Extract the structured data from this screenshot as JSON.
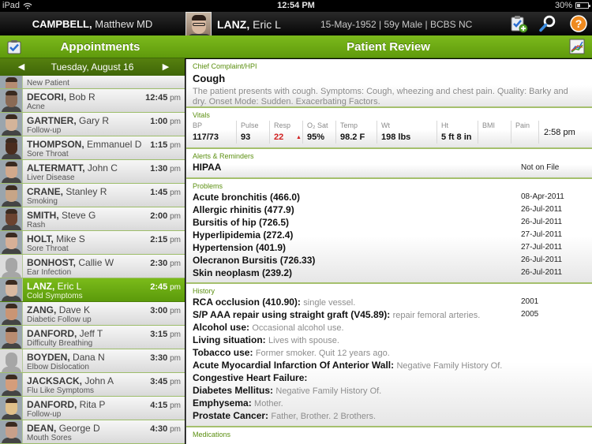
{
  "status_bar": {
    "device": "iPad",
    "time": "12:54 PM",
    "battery": "30%"
  },
  "header": {
    "doctor_last": "CAMPBELL,",
    "doctor_first": "Matthew MD",
    "patient_last": "LANZ,",
    "patient_first": "Eric L",
    "patient_meta": "15-May-1952 | 59y Male | BCBS NC",
    "icons": [
      "add-appointment-icon",
      "search-icon",
      "help-icon"
    ]
  },
  "appointments": {
    "title": "Appointments",
    "date": "Tuesday, August 16",
    "prev_label": "◀",
    "next_label": "▶",
    "items": [
      {
        "last": "",
        "first": "",
        "reason": "New Patient",
        "time": "",
        "ampm": "",
        "photo": "#b58c72",
        "partial": true
      },
      {
        "last": "DECORI,",
        "first": "Bob R",
        "reason": "Acne",
        "time": "12:45",
        "ampm": "pm",
        "photo": "#8a6a55"
      },
      {
        "last": "GARTNER,",
        "first": "Gary R",
        "reason": "Follow-up",
        "time": "1:00",
        "ampm": "pm",
        "photo": "#d4b49a"
      },
      {
        "last": "THOMPSON,",
        "first": "Emmanuel D",
        "reason": "Sore Throat",
        "time": "1:15",
        "ampm": "pm",
        "photo": "#4a2d1e"
      },
      {
        "last": "ALTERMATT,",
        "first": "John C",
        "reason": "Liver Disease",
        "time": "1:30",
        "ampm": "pm",
        "photo": "#d2a98c"
      },
      {
        "last": "CRANE,",
        "first": "Stanley R",
        "reason": "Smoking",
        "time": "1:45",
        "ampm": "pm",
        "photo": "#c7a587"
      },
      {
        "last": "SMITH,",
        "first": "Steve G",
        "reason": "Rash",
        "time": "2:00",
        "ampm": "pm",
        "photo": "#6b4330"
      },
      {
        "last": "HOLT,",
        "first": "Mike S",
        "reason": "Sore Throat",
        "time": "2:15",
        "ampm": "pm",
        "photo": "#d6b097"
      },
      {
        "last": "BONHOST,",
        "first": "Callie W",
        "reason": "Ear Infection",
        "time": "2:30",
        "ampm": "pm",
        "photo": "ghost"
      },
      {
        "last": "LANZ,",
        "first": "Eric L",
        "reason": "Cold Symptoms",
        "time": "2:45",
        "ampm": "pm",
        "photo": "#d9b9a1",
        "selected": true
      },
      {
        "last": "ZANG,",
        "first": "Dave K",
        "reason": "Diabetic Follow up",
        "time": "3:00",
        "ampm": "pm",
        "photo": "#c99574"
      },
      {
        "last": "DANFORD,",
        "first": "Jeff T",
        "reason": "Difficulty Breathing",
        "time": "3:15",
        "ampm": "pm",
        "photo": "#b98c70"
      },
      {
        "last": "BOYDEN,",
        "first": "Dana N",
        "reason": "Elbow Dislocation",
        "time": "3:30",
        "ampm": "pm",
        "photo": "ghost"
      },
      {
        "last": "JACKSACK,",
        "first": "John A",
        "reason": "Flu Like Symptoms",
        "time": "3:45",
        "ampm": "pm",
        "photo": "#d49d7b"
      },
      {
        "last": "DANFORD,",
        "first": "Rita P",
        "reason": "Follow-up",
        "time": "4:15",
        "ampm": "pm",
        "photo": "#e0c08a"
      },
      {
        "last": "DEAN,",
        "first": "George D",
        "reason": "Mouth Sores",
        "time": "4:30",
        "ampm": "pm",
        "photo": "#c8a08a"
      }
    ]
  },
  "review": {
    "title": "Patient Review",
    "chief_complaint": {
      "label": "Chief Complaint/HPI",
      "title": "Cough",
      "text": "The patient presents with cough. Symptoms: Cough, wheezing and chest pain. Quality: Barky and dry. Onset Mode: Sudden. Exacerbating Factors."
    },
    "vitals": {
      "label": "Vitals",
      "items": [
        {
          "label": "BP",
          "value": "117/73"
        },
        {
          "label": "Pulse",
          "value": "93"
        },
        {
          "label": "Resp",
          "value": "22",
          "alert": true,
          "flag": "▲"
        },
        {
          "label": "O₂ Sat",
          "value": "95%"
        },
        {
          "label": "Temp",
          "value": "98.2 F"
        },
        {
          "label": "Wt",
          "value": "198 lbs"
        },
        {
          "label": "Ht",
          "value": "5 ft 8 in"
        },
        {
          "label": "BMI",
          "value": ""
        },
        {
          "label": "Pain",
          "value": ""
        }
      ],
      "time": "2:58 pm"
    },
    "alerts": {
      "label": "Alerts & Reminders",
      "items": [
        {
          "name": "HIPAA",
          "status": "Not on File"
        }
      ]
    },
    "problems": {
      "label": "Problems",
      "items": [
        {
          "name": "Acute bronchitis (466.0)",
          "date": "08-Apr-2011"
        },
        {
          "name": "Allergic rhinitis (477.9)",
          "date": "26-Jul-2011"
        },
        {
          "name": "Bursitis of hip (726.5)",
          "date": "26-Jul-2011"
        },
        {
          "name": "Hyperlipidemia (272.4)",
          "date": "27-Jul-2011"
        },
        {
          "name": "Hypertension (401.9)",
          "date": "27-Jul-2011"
        },
        {
          "name": "Olecranon Bursitis (726.33)",
          "date": "26-Jul-2011"
        },
        {
          "name": "Skin neoplasm (239.2)",
          "date": "26-Jul-2011"
        }
      ]
    },
    "history": {
      "label": "History",
      "items": [
        {
          "name": "RCA occlusion (410.90):",
          "note": "single vessel.",
          "date": "2001"
        },
        {
          "name": "S/P AAA repair using straight graft (V45.89):",
          "note": "repair femoral arteries.",
          "date": "2005"
        },
        {
          "name": "Alcohol use:",
          "note": "Occasional alcohol use.",
          "date": ""
        },
        {
          "name": "Living situation:",
          "note": "Lives with spouse.",
          "date": ""
        },
        {
          "name": "Tobacco use:",
          "note": "Former smoker. Quit 12 years ago.",
          "date": ""
        },
        {
          "name": "Acute Myocardial Infarction Of Anterior Wall:",
          "note": "Negative Family History Of.",
          "date": ""
        },
        {
          "name": "Congestive Heart Failure:",
          "note": "",
          "date": ""
        },
        {
          "name": "Diabetes Mellitus:",
          "note": "Negative Family History Of.",
          "date": ""
        },
        {
          "name": "Emphysema:",
          "note": "Mother.",
          "date": ""
        },
        {
          "name": "Prostate Cancer:",
          "note": "Father, Brother. 2 Brothers.",
          "date": ""
        }
      ]
    },
    "medications": {
      "label": "Medications"
    }
  },
  "colors": {
    "accent_green": "#6fae15",
    "section_label_green": "#5b8f10",
    "alert_red": "#d12020"
  }
}
